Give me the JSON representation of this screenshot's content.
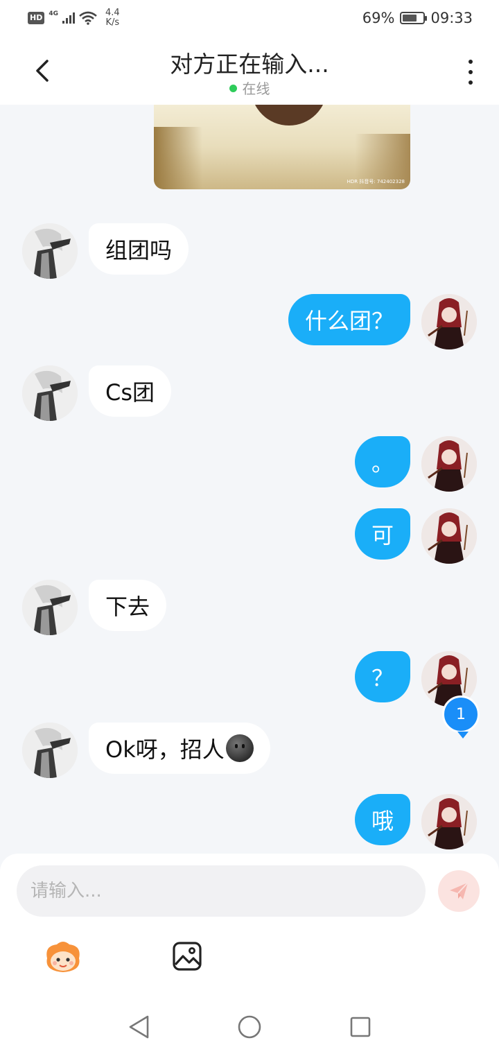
{
  "status_bar": {
    "hd": "HD",
    "network": "4G",
    "speed_value": "4.4",
    "speed_unit": "K/s",
    "battery": "69%",
    "battery_level": 0.69,
    "time": "09:33"
  },
  "header": {
    "title": "对方正在输入...",
    "status": "在线"
  },
  "image_message": {
    "watermark": "HDR 抖音号: 742402328"
  },
  "messages": [
    {
      "side": "peer",
      "text": "组团吗"
    },
    {
      "side": "self",
      "text": "什么团？"
    },
    {
      "side": "peer",
      "text": "Cs团"
    },
    {
      "side": "self",
      "text": "。"
    },
    {
      "side": "self",
      "text": "可"
    },
    {
      "side": "peer",
      "text": "下去"
    },
    {
      "side": "self",
      "text": "？"
    },
    {
      "side": "peer",
      "text": "Ok呀，招人",
      "emoji": "smiling-face-emoji"
    },
    {
      "side": "self",
      "text": "哦"
    }
  ],
  "unread_badge": "1",
  "input": {
    "placeholder": "请输入..."
  },
  "icons": {
    "back": "chevron-left-icon",
    "more": "more-vertical-icon",
    "send": "send-icon",
    "emoji": "emoji-sticker-icon",
    "image": "image-icon"
  },
  "colors": {
    "self_bubble": "#1aaef8",
    "peer_bubble": "#ffffff",
    "online": "#2ecc5a",
    "badge": "#1a8ef8",
    "send_button": "#fbe3e0"
  }
}
